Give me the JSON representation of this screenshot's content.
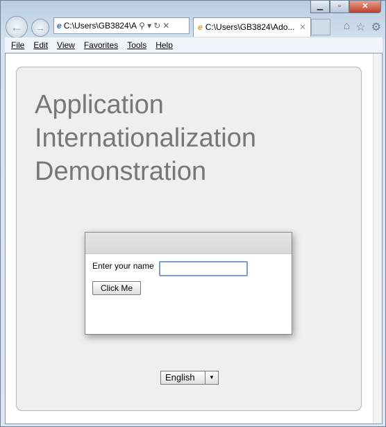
{
  "browser": {
    "address": "C:\\Users\\GB3824\\A",
    "tab_title": "C:\\Users\\GB3824\\Ado...",
    "menu": [
      "File",
      "Edit",
      "View",
      "Favorites",
      "Tools",
      "Help"
    ]
  },
  "page": {
    "title_lines": [
      "Application",
      "Internationalization",
      "Demonstration"
    ],
    "name_label": "Enter your name",
    "name_value": "",
    "button_label": "Click Me",
    "language": "English"
  }
}
